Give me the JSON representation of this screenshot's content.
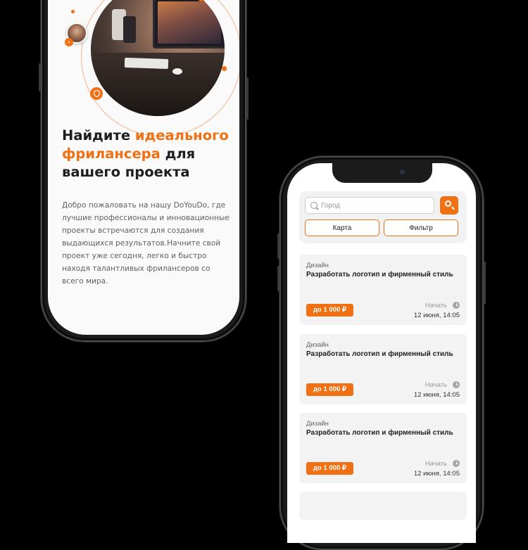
{
  "hero": {
    "title_part1": "Найдите ",
    "title_accent": "идеального фрилансера",
    "title_part2": " для вашего проекта",
    "text": "Добро пожаловать на нашу DoYouDo, где лучшие профессионалы и инновационные проекты встречаются для создания выдающихся результатов.Начните свой проект уже сегодня, легко и быстро находя талантливых фрилансеров со всего мира."
  },
  "search": {
    "placeholder": "Город",
    "map_label": "Карта",
    "filter_label": "Фильтр"
  },
  "tasks": [
    {
      "category": "Дизайн",
      "title": "Разработать логотип и фирменный стиль",
      "price": "до 1 000 ₽",
      "start_label": "Начать",
      "date": "12 июня, 14:05"
    },
    {
      "category": "Дизайн",
      "title": "Разработать логотип и фирменный стиль",
      "price": "до 1 000 ₽",
      "start_label": "Начать",
      "date": "12 июня, 14:05"
    },
    {
      "category": "Дизайн",
      "title": "Разработать логотип и фирменный стиль",
      "price": "до 1 000 ₽",
      "start_label": "Начать",
      "date": "12 июня, 14:05"
    }
  ],
  "colors": {
    "accent": "#f07014",
    "card_bg": "#f3f3f3",
    "page_bg": "#000000"
  }
}
